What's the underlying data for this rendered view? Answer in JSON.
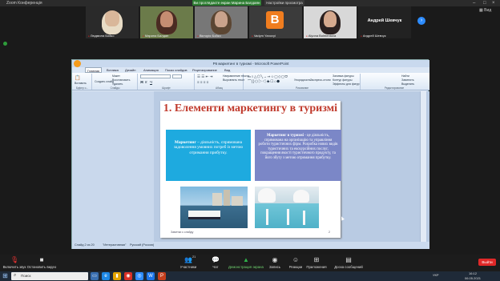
{
  "window": {
    "title": "Zoom Конференція",
    "share_banner": "Ви проглядаєте екран Марина Балдаян",
    "share_settings": "Настройки просмотра",
    "gallery_view_label": "Вид"
  },
  "participants": [
    {
      "name": "Людмила Бойко"
    },
    {
      "name": "Марина Балдан"
    },
    {
      "name": "Вікторія Бойко"
    },
    {
      "name": "Vadym Yanovyi",
      "initial": "B"
    },
    {
      "name": "Alyona Bolmentova"
    },
    {
      "name": "Андрей Шевчук",
      "display_name": "Андрей Шевчук"
    }
  ],
  "ppt": {
    "title": "Р6 маркетинг в туризмі - Microsoft PowerPoint",
    "tabs": [
      "Главная",
      "Вставка",
      "Дизайн",
      "Анимация",
      "Показ слайдов",
      "Рецензирование",
      "Вид"
    ],
    "ribbon": {
      "paste": "Вставить",
      "cut": "Вырезать",
      "copy": "Копировать",
      "format": "Формат по образцу",
      "create_slide": "Создать слайд",
      "layout": "Макет",
      "reset": "Восстановить",
      "delete": "Удалить",
      "find": "Найти",
      "replace": "Заменить",
      "select": "Выделить",
      "group_clipboard": "Буфер о...",
      "group_slides": "Слайды",
      "group_font": "Шрифт",
      "group_paragraph": "Абзац",
      "group_drawing": "Рисование",
      "group_editing": "Редактирование",
      "text_direction": "Направление текста",
      "align_text": "Выровнять текст",
      "smartart": "Преобразовать в SmartArt",
      "arrange": "Упорядочить",
      "quick_styles": "Экспресс-стили",
      "fill": "Заливка фигуры",
      "outline": "Контур фигуры",
      "effects": "Эффекты для фигур"
    },
    "slide": {
      "title": "1. Елементи маркетингу в туризмі",
      "left_bold": "Маркетинг",
      "left_text": " – діяльність, спрямована задоволення умовних потреб із метою отримання прибутку.",
      "right_bold": "Маркетинг в туризмі",
      "right_text": " - це діяльність, спрямована на організацію та управління роботи туристичних фірм. Розробка нових видів туристичних та екскурсійних послуг, покращення якості туристичного продукту, та його збуту з метою отримання прибутку.",
      "notes": "Заметки к слайду",
      "number": "2"
    },
    "status": {
      "slide": "Слайд 2 из 20",
      "theme": "\"Интерактивная\"",
      "lang": "Русский (Россия)"
    }
  },
  "toolbar": {
    "mic": "Включить звук",
    "video": "Остановить видео",
    "participants": "Участники",
    "participants_count": "21",
    "chat": "Чат",
    "share": "Демонстрация экрана",
    "polls": "Запись",
    "reactions": "Реакции",
    "apps": "Приложения",
    "whiteboard": "Доска сообщений",
    "leave": "Выйти"
  },
  "taskbar": {
    "search": "Поиск",
    "time": "16:12",
    "date": "06.05.2021",
    "lang": "УКР"
  }
}
